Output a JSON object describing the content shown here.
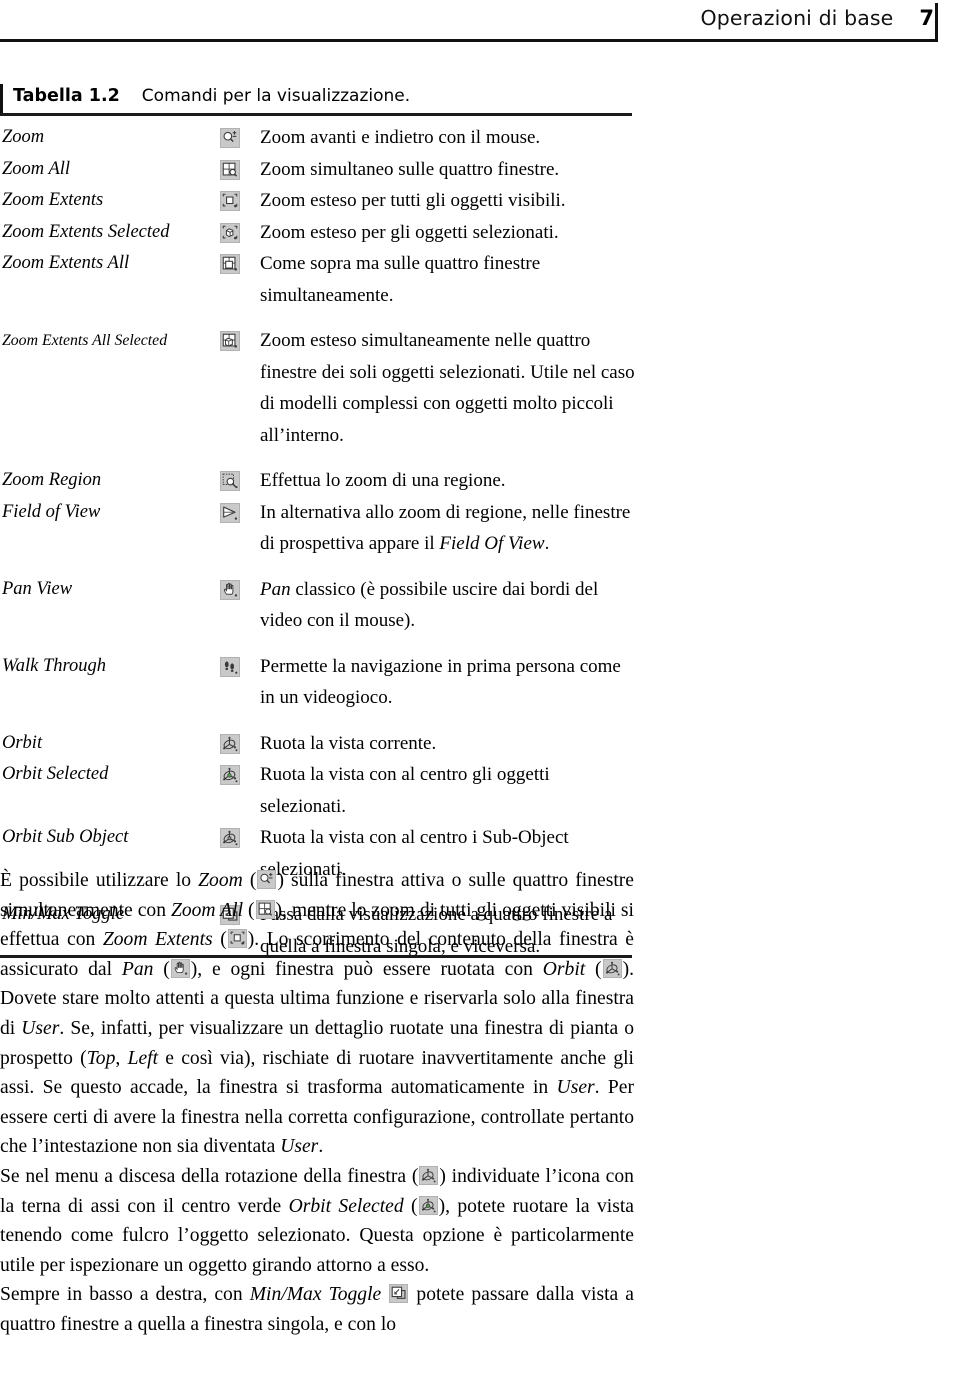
{
  "running_head": {
    "title": "Operazioni di base",
    "page_number": "7"
  },
  "table": {
    "caption_label": "Tabella 1.2",
    "caption_text": "Comandi per la visualizzazione.",
    "rows": [
      {
        "command": "Zoom",
        "icon": "zoom-magnifier-icon",
        "description": "Zoom avanti e indietro con il mouse."
      },
      {
        "command": "Zoom All",
        "icon": "zoom-all-four-viewports-icon",
        "description": "Zoom simultaneo sulle quattro finestre."
      },
      {
        "command": "Zoom Extents",
        "icon": "zoom-extents-icon",
        "description": "Zoom esteso per tutti gli oggetti visibili."
      },
      {
        "command": "Zoom Extents Selected",
        "icon": "zoom-extents-selected-icon",
        "description": "Zoom esteso per gli oggetti selezionati."
      },
      {
        "command": "Zoom Extents All",
        "icon": "zoom-extents-all-icon",
        "description": "Come sopra ma sulle quattro finestre simultaneamente."
      },
      {
        "command": "Zoom Extents All Selected",
        "icon": "zoom-extents-all-selected-icon",
        "description": "Zoom esteso simultaneamente nelle quattro finestre dei soli oggetti selezionati. Utile nel caso di modelli complessi con oggetti molto piccoli all’interno."
      },
      {
        "command": "Zoom Region",
        "icon": "zoom-region-icon",
        "description": "Effettua lo zoom di una regione."
      },
      {
        "command": "Field of View",
        "icon": "field-of-view-icon",
        "description": "In alternativa allo zoom di regione, nelle finestre di prospettiva appare il Field Of View."
      },
      {
        "command": "Pan View",
        "icon": "pan-hand-icon",
        "description": "Pan classico (è possibile uscire dai bordi del video con il mouse)."
      },
      {
        "command": "Walk Through",
        "icon": "walk-through-footprints-icon",
        "description": "Permette la navigazione in prima persona come in un videogioco."
      },
      {
        "command": "Orbit",
        "icon": "orbit-icon",
        "description": "Ruota la vista corrente."
      },
      {
        "command": "Orbit Selected",
        "icon": "orbit-selected-icon",
        "description": "Ruota la vista con al centro gli oggetti selezionati."
      },
      {
        "command": "Orbit Sub Object",
        "icon": "orbit-sub-object-icon",
        "description": "Ruota la vista con al centro i Sub-Object selezionati."
      },
      {
        "command": "Min/Max Toggle",
        "icon": "min-max-toggle-icon",
        "description": "Passa dalla visualizzazione a quattro finestre a quella a finestra singola, e viceversa."
      }
    ]
  },
  "body": {
    "para1": {
      "s1": "È possibile utilizzare lo ",
      "i1": "Zoom",
      "s2": " (",
      "s3": ") sulla finestra attiva o sulle quattro finestre simultaneamente con ",
      "i2": "Zoom All",
      "s4": " (",
      "s5": "), mentre lo zoom di tutti gli oggetti visibili si effettua con ",
      "i3": "Zoom Extents",
      "s6": " (",
      "s7": "). Lo scorrimento del contenuto della finestra è assicurato dal ",
      "i4": "Pan",
      "s8": " (",
      "s9": "), e ogni finestra può essere ruotata con ",
      "i5": "Orbit",
      "s10": " (",
      "s11": "). Dovete stare molto attenti a questa ultima funzione e riservarla solo alla finestra di ",
      "i6": "User",
      "s12": ". Se, infatti, per visualizzare un dettaglio ruotate una finestra di pianta o prospetto (",
      "i7": "Top",
      "s13": ", ",
      "i8": "Left",
      "s14": " e così via), rischiate di ruotare inavvertitamente anche gli assi. Se questo accade, la finestra si trasforma automaticamente in ",
      "i9": "User",
      "s15": ". Per essere certi di avere la finestra nella corretta configurazione, controllate pertanto che l’intestazione non sia diventata ",
      "i10": "User",
      "s16": "."
    },
    "para2": {
      "s1": "Se nel menu a discesa della rotazione della finestra (",
      "s2": ") individuate l’icona con la terna di assi con il centro verde ",
      "i1": "Orbit Selected",
      "s3": " (",
      "s4": "), potete ruotare la vista tenendo come fulcro l’oggetto selezionato. Questa opzione è particolarmente utile per ispezionare un oggetto girando attorno a esso."
    },
    "para3": {
      "s1": "Sempre in basso a destra, con ",
      "i1": "Min/Max Toggle",
      "s2": " ",
      "s3": " potete passare dalla vista a quattro finestre a quella a finestra singola, e con lo"
    }
  },
  "colors": {
    "rule": "#1a1a1a",
    "icon_background": "#c9c9c9",
    "icon_line": "#3b3b3b",
    "text": "#000000"
  }
}
